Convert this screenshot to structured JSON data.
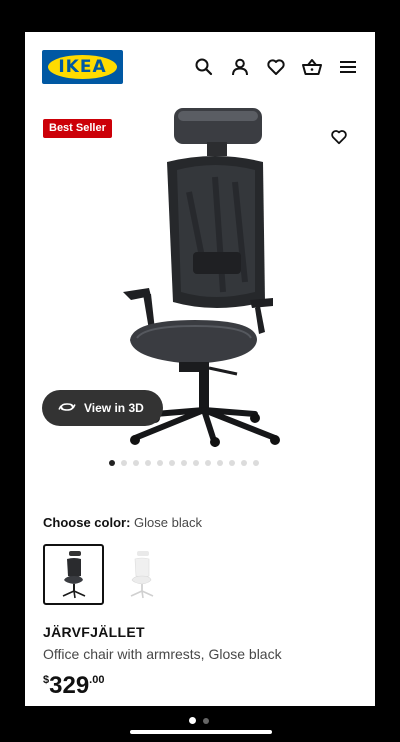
{
  "header": {
    "logo_text": "IKEA",
    "icons": [
      "search-icon",
      "account-icon",
      "heart-icon",
      "basket-icon",
      "menu-icon"
    ]
  },
  "product_media": {
    "badge": "Best Seller",
    "view_3d_label": "View in 3D",
    "image_count": 13,
    "active_image_index": 0
  },
  "color": {
    "label": "Choose color:",
    "value": "Glose black",
    "options": [
      "Glose black",
      "White"
    ]
  },
  "product": {
    "name": "JÄRVFJÄLLET",
    "description": "Office chair with armrests, Glose black",
    "price_currency": "$",
    "price_integer": "329",
    "price_decimal": ".00"
  },
  "system": {
    "page_count": 2,
    "active_page": 0
  },
  "colors": {
    "brand_blue": "#0058a3",
    "brand_yellow": "#ffdb00",
    "badge_red": "#cc0008"
  }
}
